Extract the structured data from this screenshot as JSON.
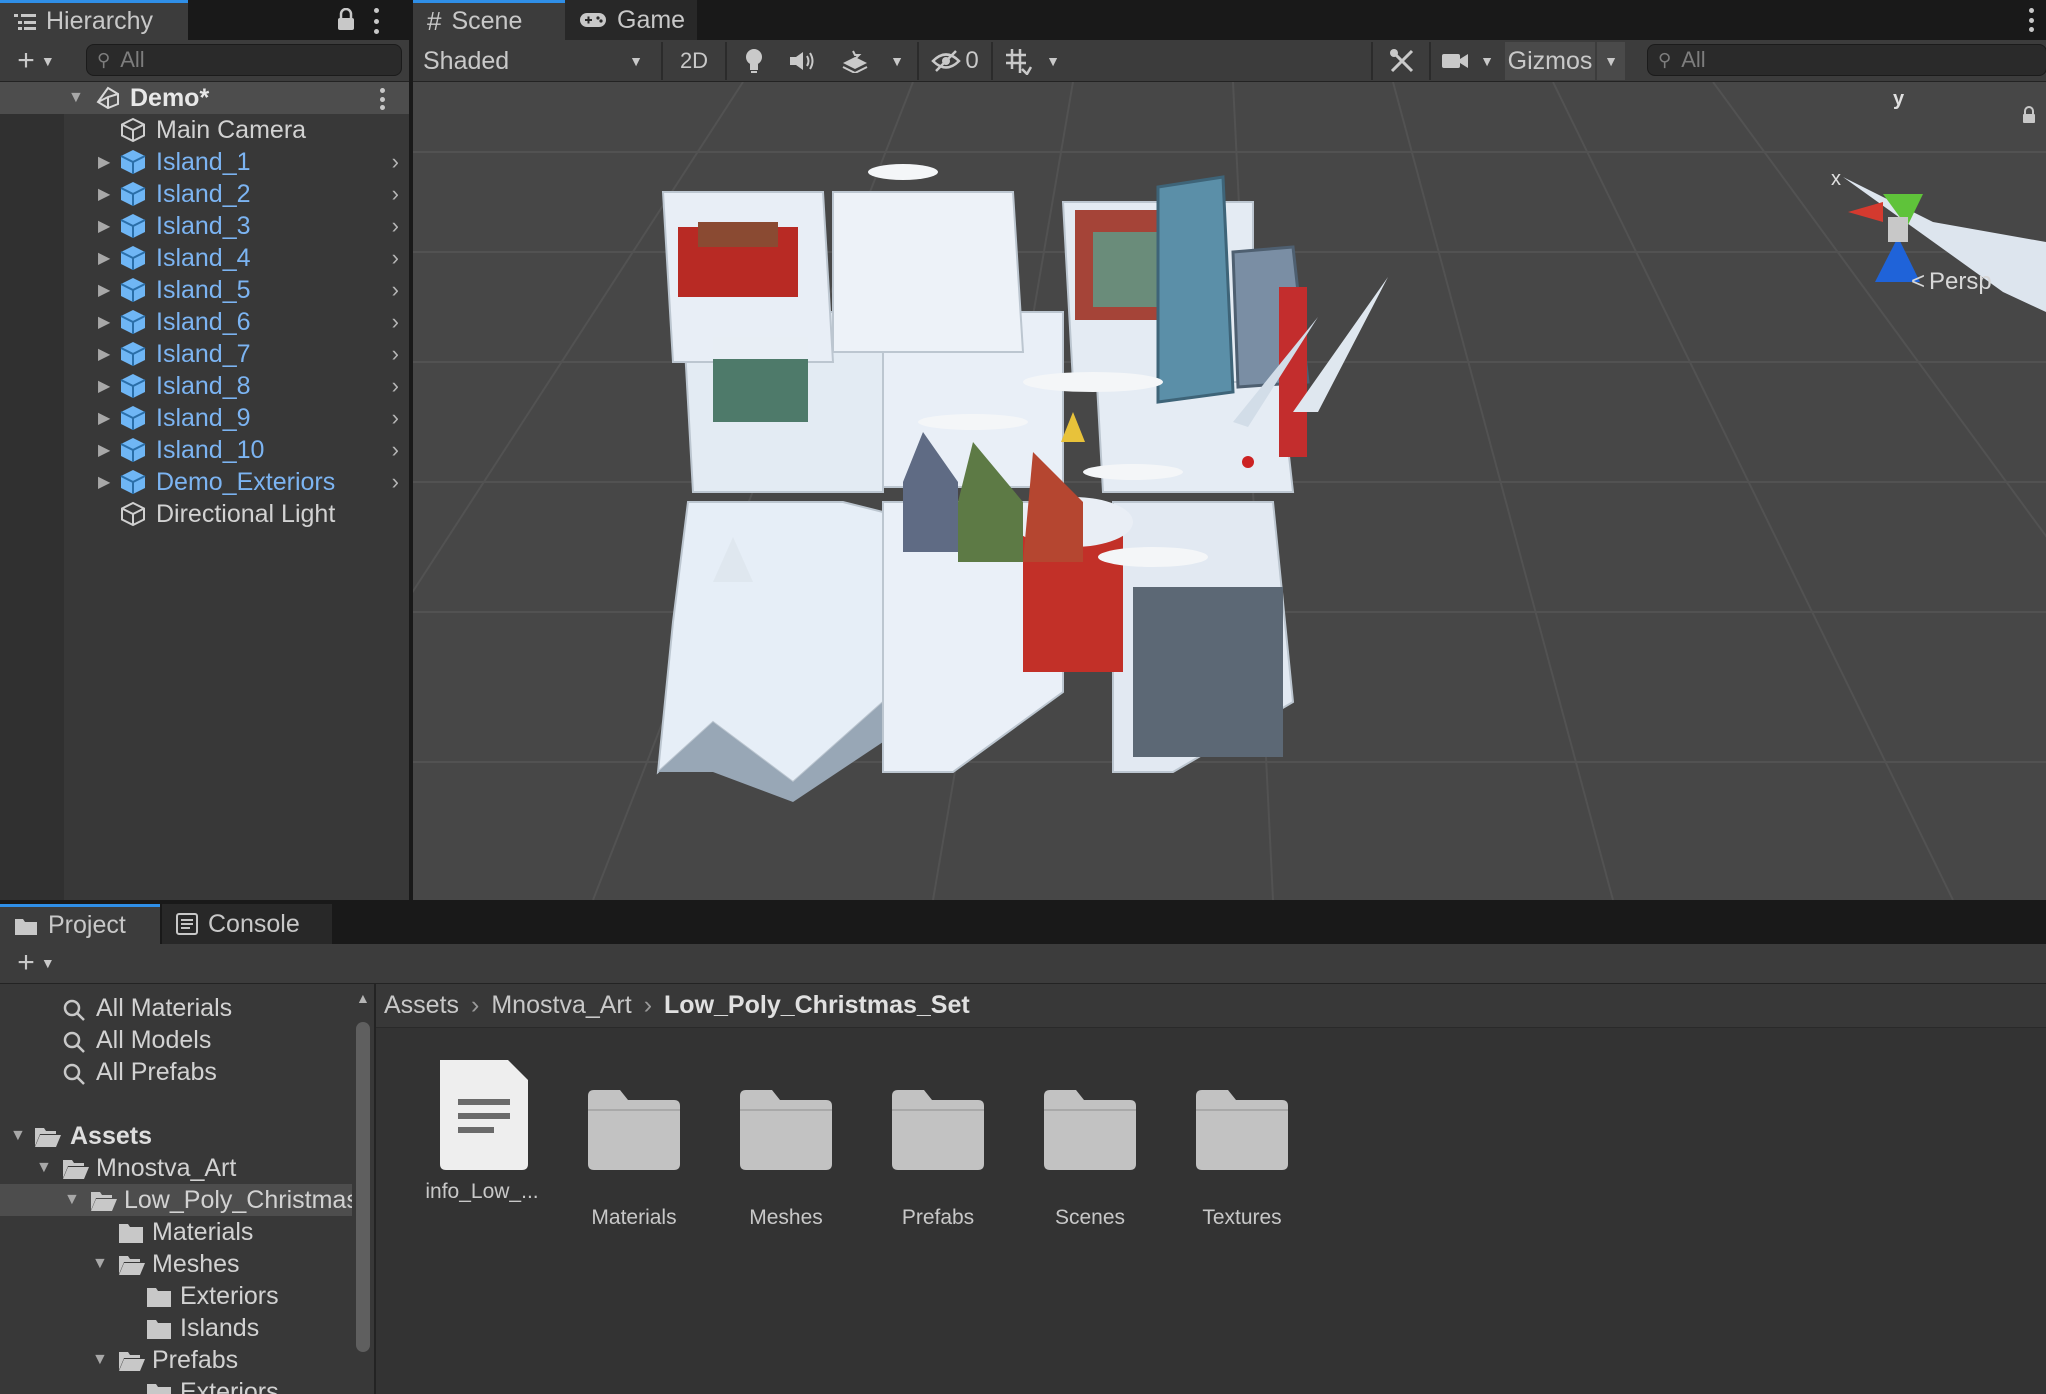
{
  "hierarchy": {
    "tab_label": "Hierarchy",
    "search_placeholder": "All",
    "scene_name": "Demo*",
    "items": [
      {
        "label": "Main Camera",
        "prefab": false,
        "expandable": false
      },
      {
        "label": "Island_1",
        "prefab": true,
        "expandable": true
      },
      {
        "label": "Island_2",
        "prefab": true,
        "expandable": true
      },
      {
        "label": "Island_3",
        "prefab": true,
        "expandable": true
      },
      {
        "label": "Island_4",
        "prefab": true,
        "expandable": true
      },
      {
        "label": "Island_5",
        "prefab": true,
        "expandable": true
      },
      {
        "label": "Island_6",
        "prefab": true,
        "expandable": true
      },
      {
        "label": "Island_7",
        "prefab": true,
        "expandable": true
      },
      {
        "label": "Island_8",
        "prefab": true,
        "expandable": true
      },
      {
        "label": "Island_9",
        "prefab": true,
        "expandable": true
      },
      {
        "label": "Island_10",
        "prefab": true,
        "expandable": true
      },
      {
        "label": "Demo_Exteriors",
        "prefab": true,
        "expandable": true
      },
      {
        "label": "Directional Light",
        "prefab": false,
        "expandable": false
      }
    ]
  },
  "scene_view": {
    "tabs": [
      {
        "label": "Scene",
        "icon": "grid-icon"
      },
      {
        "label": "Game",
        "icon": "gamepad-icon"
      }
    ],
    "shading_mode": "Shaded",
    "mode_2d_label": "2D",
    "hidden_count": "0",
    "gizmos_label": "Gizmos",
    "search_placeholder": "All",
    "gizmo_axes": {
      "y": "y",
      "x": "x"
    },
    "projection_label": "Persp"
  },
  "project": {
    "tabs": [
      {
        "label": "Project",
        "icon": "folder-icon"
      },
      {
        "label": "Console",
        "icon": "console-icon"
      }
    ],
    "favorites": [
      "All Materials",
      "All Models",
      "All Prefabs"
    ],
    "tree": {
      "root": "Assets",
      "level1": "Mnostva_Art",
      "level2": "Low_Poly_Christmas_Set",
      "children": [
        "Materials",
        "Meshes",
        "Exteriors",
        "Islands",
        "Prefabs",
        "Exteriors"
      ]
    },
    "breadcrumb": [
      "Assets",
      "Mnostva_Art",
      "Low_Poly_Christmas_Set"
    ],
    "assets": [
      {
        "label": "info_Low_...",
        "kind": "document"
      },
      {
        "label": "Materials",
        "kind": "folder"
      },
      {
        "label": "Meshes",
        "kind": "folder"
      },
      {
        "label": "Prefabs",
        "kind": "folder"
      },
      {
        "label": "Scenes",
        "kind": "folder"
      },
      {
        "label": "Textures",
        "kind": "folder"
      }
    ]
  },
  "colors": {
    "panel": "#383838",
    "toolbar": "#3c3c3c",
    "scene_bg": "#474747",
    "selected_row": "#4d4d4d",
    "prefab_blue": "#7cb4f2",
    "accent": "#2f8fe8"
  }
}
